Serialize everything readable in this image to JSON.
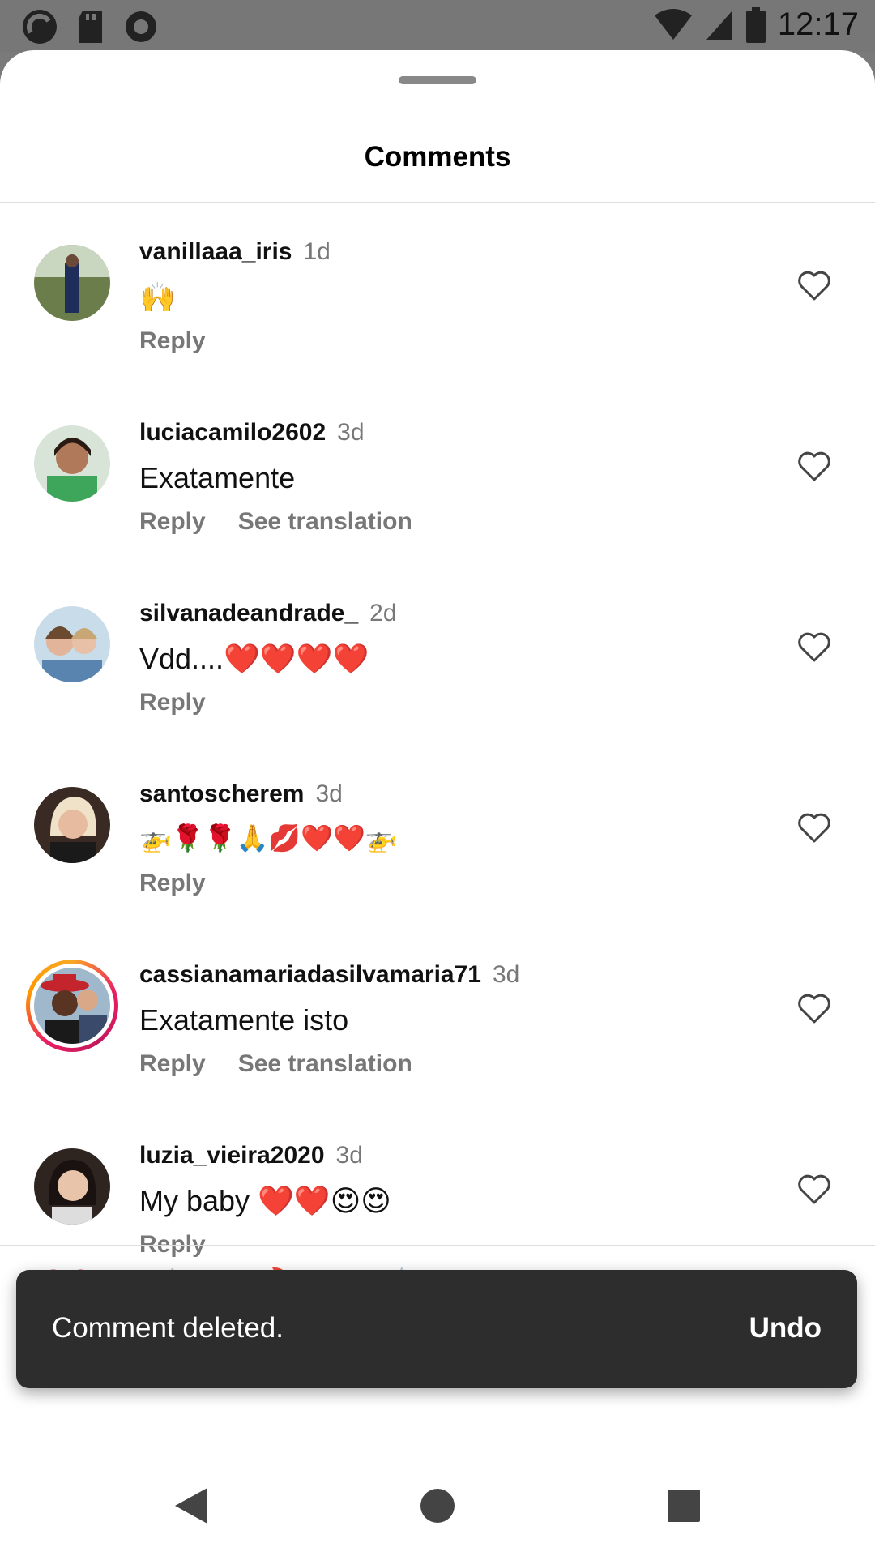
{
  "status_bar": {
    "time": "12:17"
  },
  "sheet": {
    "title": "Comments"
  },
  "comments": [
    {
      "username": "vanillaaa_iris",
      "time": "1d",
      "text": "🙌",
      "reply": "Reply",
      "translate": ""
    },
    {
      "username": "luciacamilo2602",
      "time": "3d",
      "text": "Exatamente",
      "reply": "Reply",
      "translate": "See translation"
    },
    {
      "username": "silvanadeandrade_",
      "time": "2d",
      "text": "Vdd....❤️❤️❤️❤️",
      "reply": "Reply",
      "translate": ""
    },
    {
      "username": "santoscherem",
      "time": "3d",
      "text": "🚁🌹🌹🙏💋❤️❤️🚁",
      "reply": "Reply",
      "translate": ""
    },
    {
      "username": "cassianamariadasilvamaria71",
      "time": "3d",
      "text": "Exatamente isto",
      "reply": "Reply",
      "translate": "See translation"
    },
    {
      "username": "luzia_vieira2020",
      "time": "3d",
      "text": "My baby ❤️❤️😍😍",
      "reply": "Reply",
      "translate": ""
    }
  ],
  "quick_reactions": [
    "❤️",
    "🙌",
    "🔥",
    "👏",
    "😢",
    "😍",
    "😮",
    "😂"
  ],
  "snackbar": {
    "message": "Comment deleted.",
    "action": "Undo"
  }
}
